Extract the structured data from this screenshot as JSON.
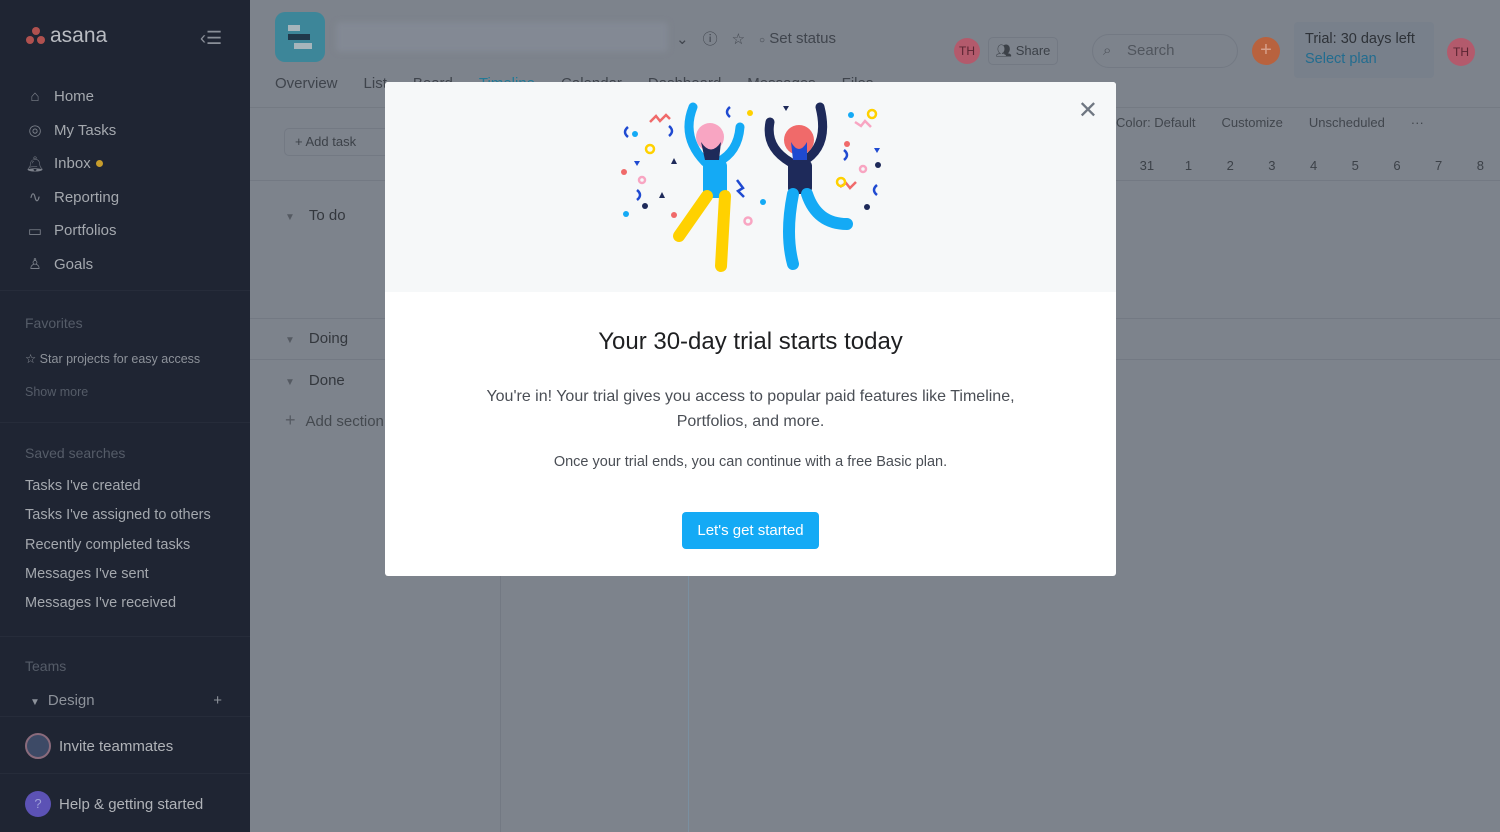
{
  "sidebar": {
    "logo": "asana",
    "nav": [
      {
        "label": "Home",
        "icon": "home-icon"
      },
      {
        "label": "My Tasks",
        "icon": "check-circle-icon"
      },
      {
        "label": "Inbox",
        "icon": "bell-icon"
      },
      {
        "label": "Reporting",
        "icon": "chart-line-icon"
      },
      {
        "label": "Portfolios",
        "icon": "folder-icon"
      },
      {
        "label": "Goals",
        "icon": "person-icon"
      }
    ],
    "favorites_title": "Favorites",
    "favorites_hint": "☆ Star projects for easy access",
    "show_more": "Show more",
    "saved_title": "Saved searches",
    "saved": [
      "Tasks I've created",
      "Tasks I've assigned to others",
      "Recently completed tasks",
      "Messages I've sent",
      "Messages I've received"
    ],
    "teams_title": "Teams",
    "team": "Design",
    "invite": "Invite teammates",
    "help": "Help & getting started",
    "inbox_dot_color": "#c79d2c"
  },
  "header": {
    "set_status": "Set status",
    "tabs": [
      "Overview",
      "List",
      "Board",
      "Timeline",
      "Calendar",
      "Dashboard",
      "Messages",
      "Files"
    ],
    "avatar": "TH",
    "share": "Share",
    "search_placeholder": "Search",
    "trial": "Trial: 30 days left",
    "select_plan": "Select plan"
  },
  "toolbar": {
    "add_task": "+ Add task",
    "color": "Color: Default",
    "customize": "Customize",
    "unscheduled": "Unscheduled",
    "more": "···",
    "dates": [
      "31",
      "1",
      "2",
      "3",
      "4",
      "5",
      "6",
      "7",
      "8"
    ]
  },
  "sections": [
    "To do",
    "Doing",
    "Done"
  ],
  "add_section": "Add section",
  "modal": {
    "title": "Your 30-day trial starts today",
    "lead": "You're in! Your trial gives you access to popular paid features like Timeline, Portfolios, and more.",
    "sub": "Once your trial ends, you can continue with a free Basic plan.",
    "cta": "Let's get started",
    "cta_color": "#14aaf5"
  }
}
